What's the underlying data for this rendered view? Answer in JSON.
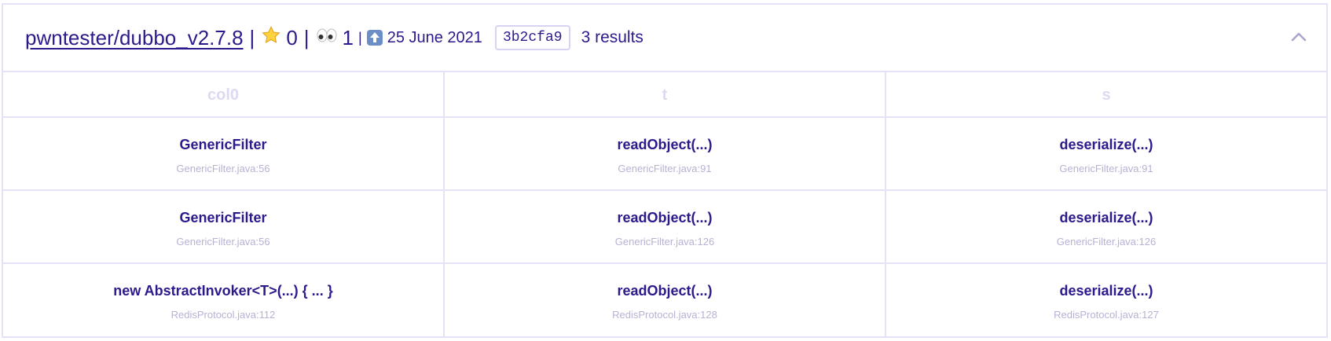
{
  "header": {
    "repo_name": "pwntester/dubbo_v2.7.8",
    "stars": "0",
    "watchers": "1",
    "updated": "25 June 2021",
    "commit_sha": "3b2cfa9",
    "results": "3 results",
    "separator": "|",
    "icons": {
      "star": "star-icon",
      "watchers": "eyes-icon",
      "updated": "up-arrow-icon",
      "collapse": "chevron-up-icon"
    }
  },
  "table": {
    "columns": [
      "col0",
      "t",
      "s"
    ],
    "rows": [
      [
        {
          "title": "GenericFilter",
          "location": "GenericFilter.java:56"
        },
        {
          "title": "readObject(...)",
          "location": "GenericFilter.java:91"
        },
        {
          "title": "deserialize(...)",
          "location": "GenericFilter.java:91"
        }
      ],
      [
        {
          "title": "GenericFilter",
          "location": "GenericFilter.java:56"
        },
        {
          "title": "readObject(...)",
          "location": "GenericFilter.java:126"
        },
        {
          "title": "deserialize(...)",
          "location": "GenericFilter.java:126"
        }
      ],
      [
        {
          "title": "new AbstractInvoker<T>(...) { ... }",
          "location": "RedisProtocol.java:112"
        },
        {
          "title": "readObject(...)",
          "location": "RedisProtocol.java:128"
        },
        {
          "title": "deserialize(...)",
          "location": "RedisProtocol.java:127"
        }
      ]
    ]
  },
  "colors": {
    "primary_text": "#2c1a8c",
    "border": "#e4e2f7",
    "muted": "#b6b2d4",
    "column_header": "#dcd9f2"
  }
}
